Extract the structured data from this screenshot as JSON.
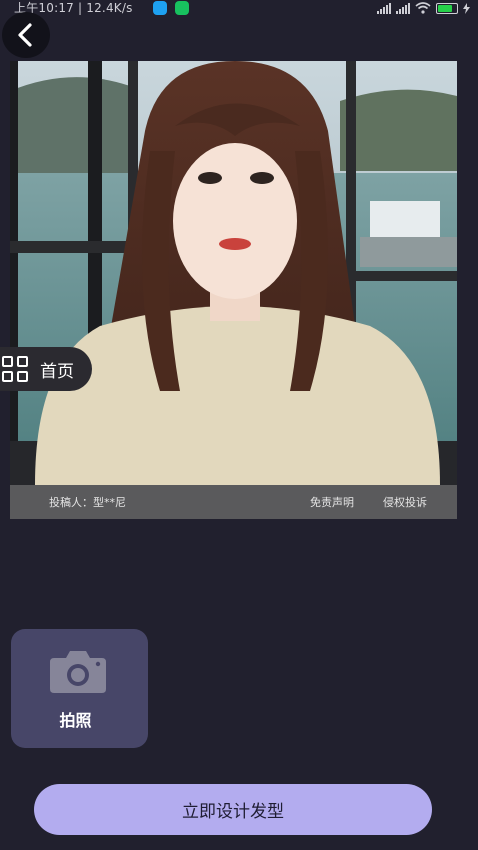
{
  "status_bar": {
    "time_speed": "上午10:17 | 12.4K/s",
    "icons": [
      "message-icon",
      "wechat-icon",
      "hd-signal-icon",
      "hd-signal-icon",
      "wifi-icon",
      "battery-icon",
      "charging-icon"
    ]
  },
  "header": {
    "back_icon": "chevron-left-icon"
  },
  "photo": {
    "submitter": "投稿人：型**尼",
    "disclaimer": "免责声明",
    "complaint": "侵权投诉"
  },
  "home_button": {
    "label": "首页",
    "icon": "grid-icon"
  },
  "camera_tile": {
    "label": "拍照",
    "icon": "camera-icon"
  },
  "primary_action": {
    "label": "立即设计发型"
  },
  "colors": {
    "background": "#21202e",
    "tile": "#474668",
    "primary_button": "#b3acef",
    "footer_bar": "#5a5a5c"
  }
}
